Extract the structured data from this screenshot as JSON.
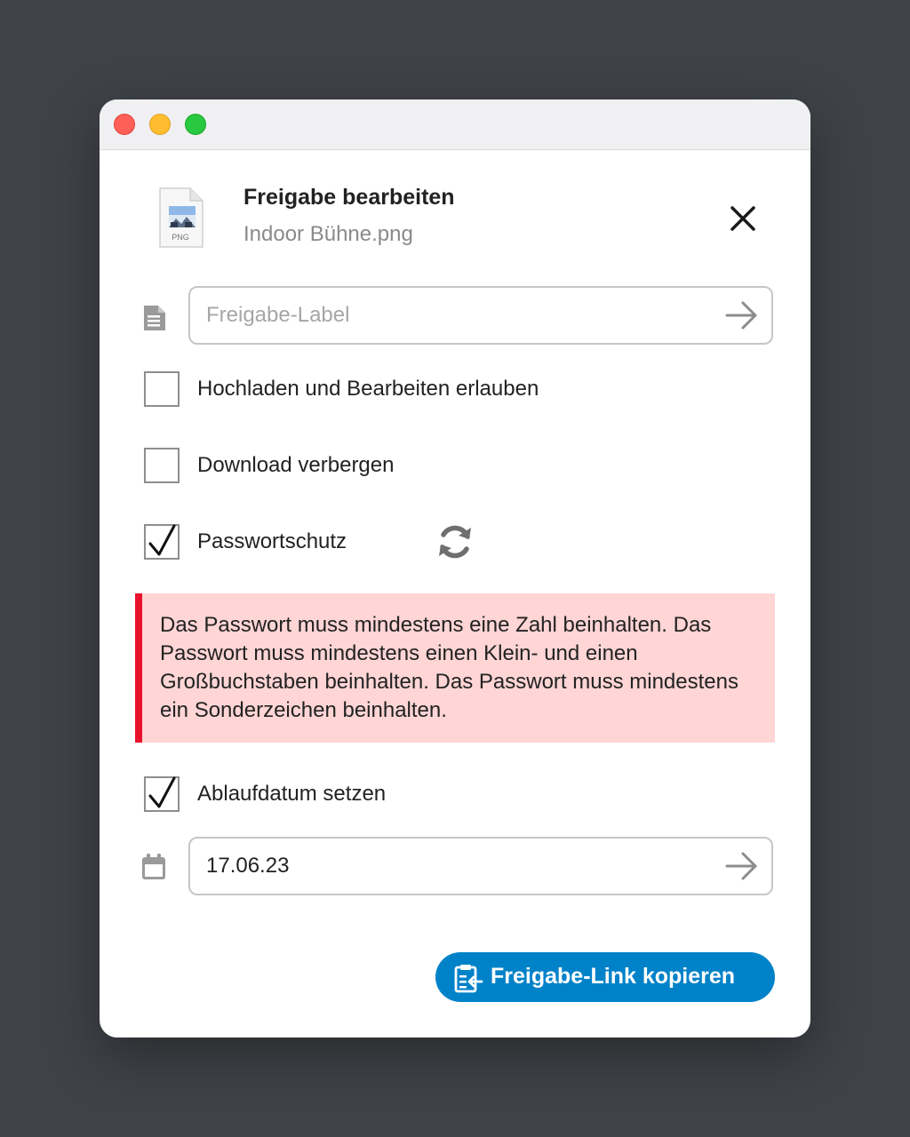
{
  "window": {
    "traffic_lights": [
      "close",
      "minimize",
      "zoom"
    ]
  },
  "header": {
    "title": "Freigabe bearbeiten",
    "filename": "Indoor Bühne.png",
    "file_type_label": "PNG"
  },
  "label_field": {
    "placeholder": "Freigabe-Label",
    "value": "",
    "icon": "document-icon",
    "submit_icon": "arrow-right-icon"
  },
  "options": [
    {
      "label": "Hochladen und Bearbeiten erlauben",
      "checked": false
    },
    {
      "label": "Download verbergen",
      "checked": false
    },
    {
      "label": "Passwortschutz",
      "checked": true
    }
  ],
  "error": {
    "message": "Das Passwort muss mindestens eine Zahl beinhalten. Das Passwort muss mindestens einen Klein- und einen Großbuchstaben beinhalten.  Das Passwort muss mindestens ein Sonderzeichen beinhalten.",
    "accent_color": "#e9122c",
    "background_color": "#ffd5d5"
  },
  "expiry": {
    "label": "Ablaufdatum setzen",
    "checked": true,
    "date_value": "17.06.23",
    "icon": "calendar-icon"
  },
  "copy_button": {
    "label": "Freigabe-Link kopieren",
    "color": "#0082c9",
    "icon": "clipboard-icon"
  }
}
